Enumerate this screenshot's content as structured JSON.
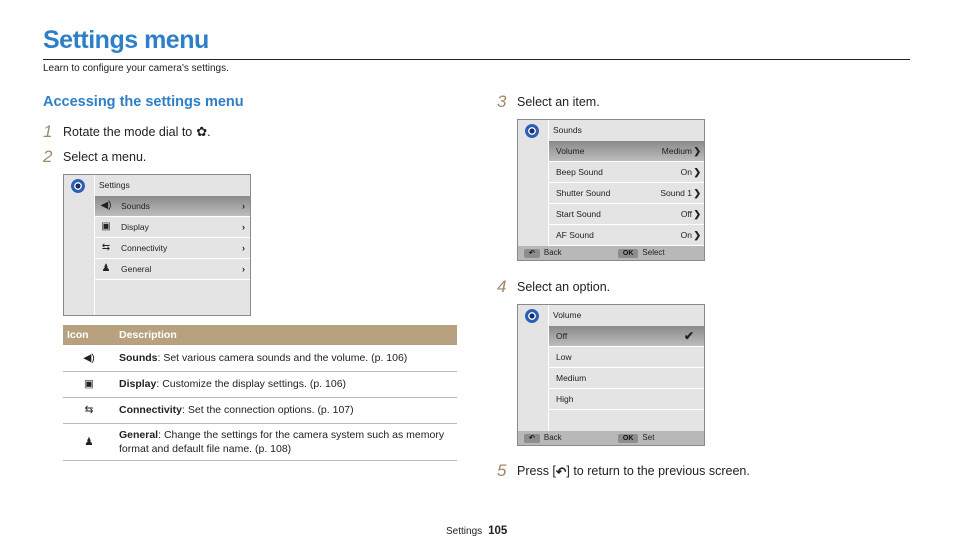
{
  "header": {
    "title": "Settings menu",
    "subtitle": "Learn to configure your camera's settings."
  },
  "section": {
    "title": "Accessing the settings menu"
  },
  "steps": [
    {
      "num": "1",
      "text": "Rotate the mode dial to",
      "icon": "settings-gear-icon"
    },
    {
      "num": "2",
      "text": "Select a menu."
    },
    {
      "num": "3",
      "text": "Select an item."
    },
    {
      "num": "4",
      "text": "Select an option."
    },
    {
      "num": "5",
      "text_before": "Press [",
      "text_after": "] to return to the previous screen.",
      "icon": "back-icon"
    }
  ],
  "screen1": {
    "title": "Settings",
    "items": [
      {
        "icon": "sound-icon",
        "label": "Sounds",
        "selected": true
      },
      {
        "icon": "display-icon",
        "label": "Display"
      },
      {
        "icon": "connectivity-icon",
        "label": "Connectivity"
      },
      {
        "icon": "general-icon",
        "label": "General"
      }
    ]
  },
  "table": {
    "headers": [
      "Icon",
      "Description"
    ],
    "rows": [
      {
        "icon": "sound-icon",
        "bold": "Sounds",
        "text": ": Set various camera sounds and the volume. (p. 106)"
      },
      {
        "icon": "display-icon",
        "bold": "Display",
        "text": ": Customize the display settings. (p. 106)"
      },
      {
        "icon": "connectivity-icon",
        "bold": "Connectivity",
        "text": ": Set the connection options. (p. 107)"
      },
      {
        "icon": "general-icon",
        "bold": "General",
        "text": ": Change the settings for the camera system such as memory format and default file name. (p. 108)"
      }
    ]
  },
  "screen2": {
    "title": "Sounds",
    "items": [
      {
        "label": "Volume",
        "value": "Medium",
        "selected": true
      },
      {
        "label": "Beep Sound",
        "value": "On"
      },
      {
        "label": "Shutter Sound",
        "value": "Sound 1"
      },
      {
        "label": "Start Sound",
        "value": "Off"
      },
      {
        "label": "AF Sound",
        "value": "On"
      }
    ],
    "footer": {
      "back": "Back",
      "ok_key": "OK",
      "ok": "Select"
    }
  },
  "screen3": {
    "title": "Volume",
    "items": [
      {
        "label": "Off",
        "selected": true,
        "checked": true
      },
      {
        "label": "Low"
      },
      {
        "label": "Medium"
      },
      {
        "label": "High"
      }
    ],
    "footer": {
      "back": "Back",
      "ok_key": "OK",
      "ok": "Set"
    }
  },
  "footer": {
    "section": "Settings",
    "page": "105"
  }
}
